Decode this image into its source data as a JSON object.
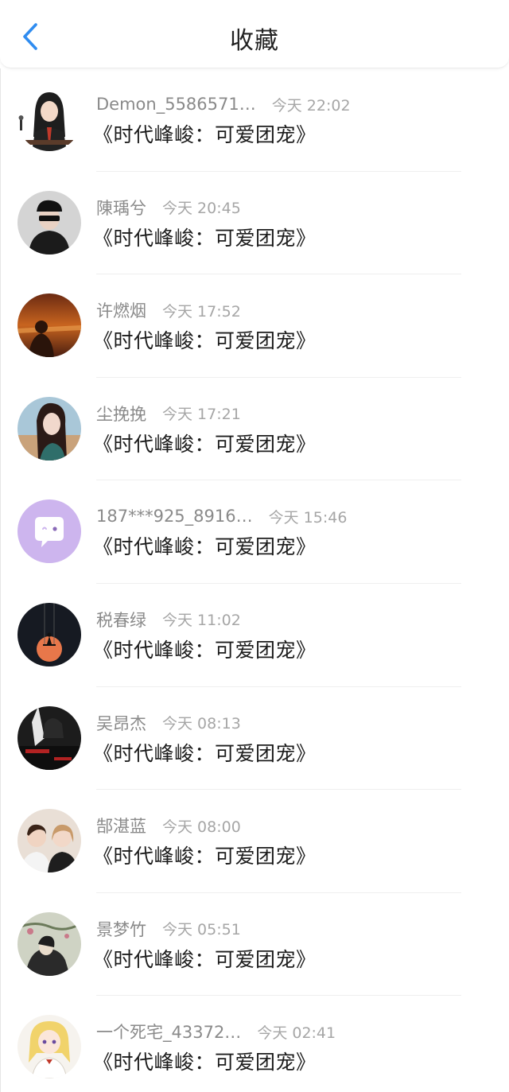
{
  "header": {
    "title": "收藏",
    "back_icon": "chevron-left-icon",
    "accent_color": "#2f8cf0"
  },
  "items": [
    {
      "name": "Demon_5586571…",
      "time": "今天 22:02",
      "title": "《时代峰峻：可爱团宠》",
      "avatar_icon": "avatar-girl-microphone"
    },
    {
      "name": "陳瑀兮",
      "time": "今天 20:45",
      "title": "《时代峰峻：可爱团宠》",
      "avatar_icon": "avatar-person-cap"
    },
    {
      "name": "许燃烟",
      "time": "今天 17:52",
      "title": "《时代峰峻：可爱团宠》",
      "avatar_icon": "avatar-sunset-sea"
    },
    {
      "name": "尘挽挽",
      "time": "今天 17:21",
      "title": "《时代峰峻：可爱团宠》",
      "avatar_icon": "avatar-girl-portrait"
    },
    {
      "name": "187***925_8916…",
      "time": "今天 15:46",
      "title": "《时代峰峻：可爱团宠》",
      "avatar_icon": "avatar-default-chat-bubble"
    },
    {
      "name": "税春绿",
      "time": "今天 11:02",
      "title": "《时代峰峻：可爱团宠》",
      "avatar_icon": "avatar-swing-moon"
    },
    {
      "name": "吴昂杰",
      "time": "今天 08:13",
      "title": "《时代峰峻：可爱团宠》",
      "avatar_icon": "avatar-dark-anime"
    },
    {
      "name": "郜湛蓝",
      "time": "今天 08:00",
      "title": "《时代峰峻：可爱团宠》",
      "avatar_icon": "avatar-couple"
    },
    {
      "name": "景梦竹",
      "time": "今天 05:51",
      "title": "《时代峰峻：可爱团宠》",
      "avatar_icon": "avatar-ink-painting"
    },
    {
      "name": "一个死宅_43372…",
      "time": "今天 02:41",
      "title": "《时代峰峻：可爱团宠》",
      "avatar_icon": "avatar-anime-girl"
    }
  ]
}
